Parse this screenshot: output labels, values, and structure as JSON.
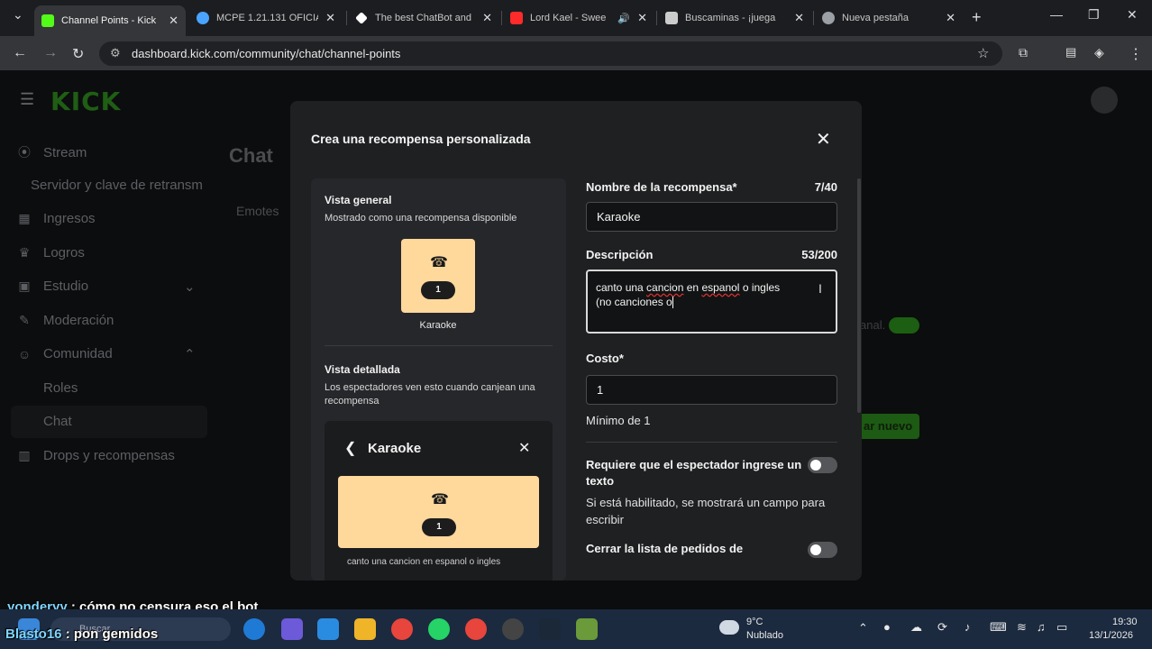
{
  "browser": {
    "tabs": [
      {
        "title": "Channel Points - Kick",
        "color": "#53fc18"
      },
      {
        "title": "MCPE 1.21.131 OFICIA",
        "color": "#4aa3ff"
      },
      {
        "title": "The best ChatBot and",
        "color": "#ffffff"
      },
      {
        "title": "Lord Kael - Swee",
        "color": "#ff2b2b"
      },
      {
        "title": "Buscaminas - ¡juega",
        "color": "#cccccc"
      },
      {
        "title": "Nueva pestaña",
        "color": "#9aa0a6"
      }
    ],
    "url": "dashboard.kick.com/community/chat/channel-points"
  },
  "sidebar": {
    "logo": "KICK",
    "items": [
      {
        "label": "Stream",
        "icon": "broadcast-icon"
      },
      {
        "label": "Servidor y clave de retransm",
        "icon": ""
      },
      {
        "label": "Ingresos",
        "icon": "money-icon"
      },
      {
        "label": "Logros",
        "icon": "trophy-icon"
      },
      {
        "label": "Estudio",
        "icon": "studio-icon"
      },
      {
        "label": "Moderación",
        "icon": "wrench-icon"
      },
      {
        "label": "Comunidad",
        "icon": "community-icon"
      },
      {
        "label": "Roles",
        "icon": ""
      },
      {
        "label": "Chat",
        "icon": ""
      },
      {
        "label": "Drops y recompensas",
        "icon": "chart-icon"
      }
    ]
  },
  "background": {
    "title": "Chat",
    "tab": "Emotes",
    "toggle_text": "anal.",
    "button": "ar nuevo"
  },
  "modal": {
    "title": "Crea una recompensa personalizada",
    "preview": {
      "general_title": "Vista general",
      "general_sub": "Mostrado como una recompensa disponible",
      "card_cost": "1",
      "card_name": "Karaoke",
      "detail_title": "Vista detallada",
      "detail_sub": "Los espectadores ven esto cuando canjean una recompensa",
      "detail_name": "Karaoke",
      "detail_cost": "1",
      "detail_desc": "canto una cancion en espanol o ingles"
    },
    "form": {
      "name_label": "Nombre de la recompensa*",
      "name_counter": "7/40",
      "name_value": "Karaoke",
      "desc_label": "Descripción",
      "desc_counter": "53/200",
      "desc_line1_a": "canto una ",
      "desc_line1_b": "cancion",
      "desc_line1_c": " en ",
      "desc_line1_d": "espanol",
      "desc_line1_e": " o ingles",
      "desc_line2": "(no canciones o",
      "cost_label": "Costo*",
      "cost_value": "1",
      "cost_hint": "Mínimo de 1",
      "toggle1_label": "Requiere que el espectador ingrese un texto",
      "toggle1_desc": "Si está habilitado, se mostrará un campo para escribir",
      "toggle2_label": "Cerrar la lista de pedidos de"
    }
  },
  "chat_overlay": [
    {
      "user": "yonderyy",
      "message": " : cómo no censura eso el bot"
    },
    {
      "user": "Blasto16",
      "message": " : pon gemidos"
    }
  ],
  "taskbar": {
    "search": "Buscar",
    "weather_temp": "9°C",
    "weather_desc": "Nublado",
    "time": "19:30",
    "date": "13/1/2026"
  }
}
